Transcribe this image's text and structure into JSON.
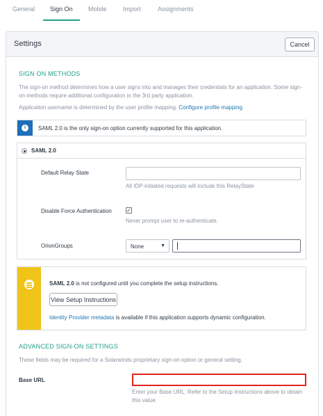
{
  "tabs": [
    {
      "label": "General"
    },
    {
      "label": "Sign On"
    },
    {
      "label": "Mobile"
    },
    {
      "label": "Import"
    },
    {
      "label": "Assignments"
    }
  ],
  "active_tab": "Sign On",
  "settings": {
    "title": "Settings",
    "cancel_label": "Cancel"
  },
  "sign_on_methods": {
    "heading": "SIGN ON METHODS",
    "description_line1": "The sign-on method determines how a user signs into and manages their credentials for an application. Some sign-",
    "description_line2": "on methods require additional configuration in the 3rd party application.",
    "username_note": "Application username is determined by the user profile mapping.",
    "profile_mapping_link": "Configure profile mapping",
    "info_text": "SAML 2.0 is the only sign-on option currently supported for this application."
  },
  "saml": {
    "option_label": "SAML 2.0",
    "relay_state_label": "Default Relay State",
    "relay_state_value": "",
    "relay_state_help": "All IDP-initiated requests will include this RelayState",
    "disable_force_auth_label": "Disable Force Authentication",
    "disable_force_auth_checked": true,
    "disable_force_auth_help": "Never prompt user to re-authenticate.",
    "orion_groups_label": "OrionGroups",
    "orion_groups_select": "None",
    "orion_groups_value": ""
  },
  "setup_notice": {
    "strong": "SAML 2.0",
    "text": "is not configured until you complete the setup instructions.",
    "button_label": "View Setup Instructions",
    "metadata_link": "Identity Provider metadata",
    "metadata_text": "is available if this application supports dynamic configuration."
  },
  "advanced": {
    "heading": "ADVANCED SIGN-ON SETTINGS",
    "description": "These fields may be required for a Solarwinds proprietary sign-on option or general setting.",
    "base_url_label": "Base URL",
    "base_url_value": "",
    "base_url_help_line1": "Enter your Base URL. Refer to the Setup Instructions above to obtain",
    "base_url_help_line2": "this value."
  },
  "colors": {
    "accent": "#23a088",
    "link": "#1f77b4",
    "info": "#1e6fb9",
    "warning": "#f0c419",
    "error_border": "#e0241b"
  }
}
